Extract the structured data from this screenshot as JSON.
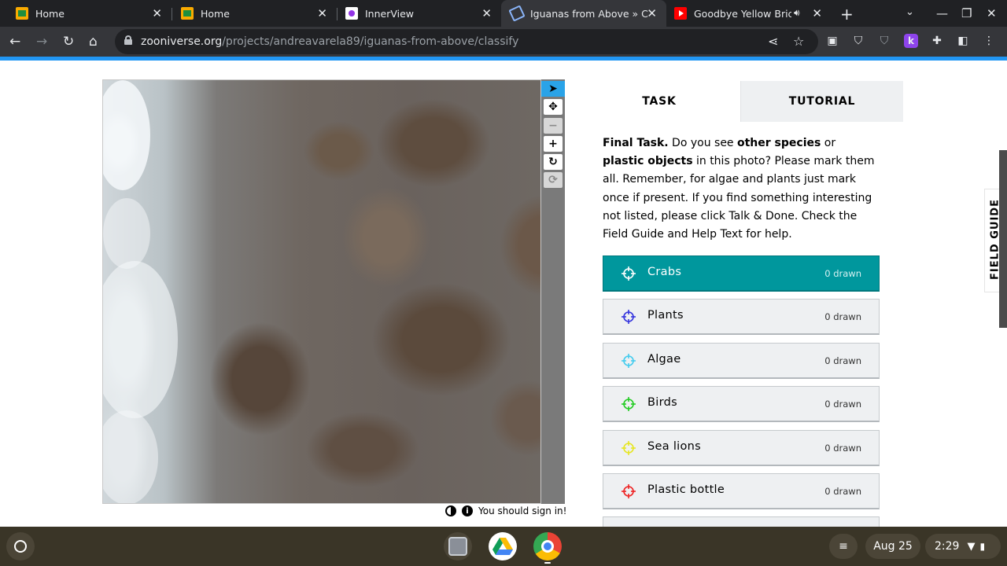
{
  "browser": {
    "tabs": [
      {
        "title": "Home",
        "icon": "photos-icon"
      },
      {
        "title": "Home",
        "icon": "photos-icon"
      },
      {
        "title": "InnerView",
        "icon": "innerview-icon"
      },
      {
        "title": "Iguanas from Above » Cla",
        "icon": "zooniverse-icon",
        "active": true
      },
      {
        "title": "Goodbye Yellow Brick",
        "icon": "youtube-icon"
      }
    ],
    "url_host": "zooniverse.org",
    "url_path": "/projects/andreavarela89/iguanas-from-above/classify"
  },
  "viewer": {
    "signin_text": "You should sign in!"
  },
  "panel": {
    "tab_task": "TASK",
    "tab_tutorial": "TUTORIAL",
    "instr": {
      "p1": "Final Task.",
      "p2": " Do you see ",
      "p3": "other species",
      "p4": " or ",
      "p5": "plastic objects",
      "p6": " in this photo? Please mark them all. Remember, for algae and plants just mark once if present. If you find something interesting not listed, please click Talk & Done. Check the Field Guide and Help Text for help."
    },
    "tools": [
      {
        "label": "Crabs",
        "count": "0 drawn",
        "color": "#ffffff",
        "active": true
      },
      {
        "label": "Plants",
        "count": "0 drawn",
        "color": "#3333dd"
      },
      {
        "label": "Algae",
        "count": "0 drawn",
        "color": "#44ccee"
      },
      {
        "label": "Birds",
        "count": "0 drawn",
        "color": "#22cc22"
      },
      {
        "label": "Sea lions",
        "count": "0 drawn",
        "color": "#e6e622"
      },
      {
        "label": "Plastic bottle",
        "count": "0 drawn",
        "color": "#ee2222"
      }
    ]
  },
  "field_guide_label": "FIELD GUIDE",
  "shelf": {
    "date": "Aug 25",
    "time": "2:29"
  }
}
